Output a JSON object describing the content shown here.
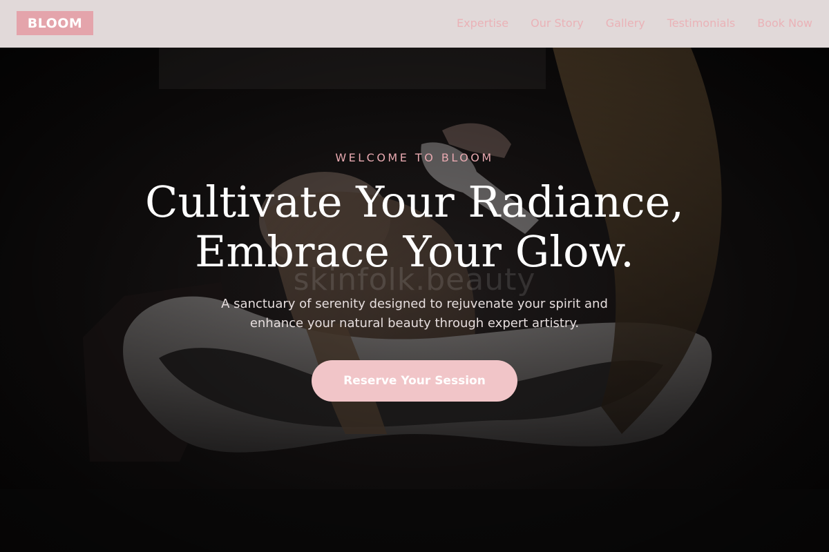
{
  "brand": {
    "logo_text": "BLOOM",
    "logo_color": "#e4a4ab"
  },
  "nav": {
    "items": [
      {
        "label": "Expertise"
      },
      {
        "label": "Our Story"
      },
      {
        "label": "Gallery"
      },
      {
        "label": "Testimonials"
      },
      {
        "label": "Book Now"
      }
    ],
    "link_color": "#eab2b7"
  },
  "hero": {
    "eyebrow": "WELCOME TO BLOOM",
    "headline_line1": "Cultivate Your Radiance,",
    "headline_line2": "Embrace Your Glow.",
    "watermark": "skinfolk.beauty",
    "subtitle_line1": "A sanctuary of serenity designed to rejuvenate your spirit and",
    "subtitle_line2": "enhance your natural beauty through expert artistry.",
    "cta_label": "Reserve Your Session",
    "cta_color": "#f1c5c8"
  },
  "colors": {
    "header_bg": "#e1d9d9",
    "accent_pink": "#e8a9b0"
  }
}
